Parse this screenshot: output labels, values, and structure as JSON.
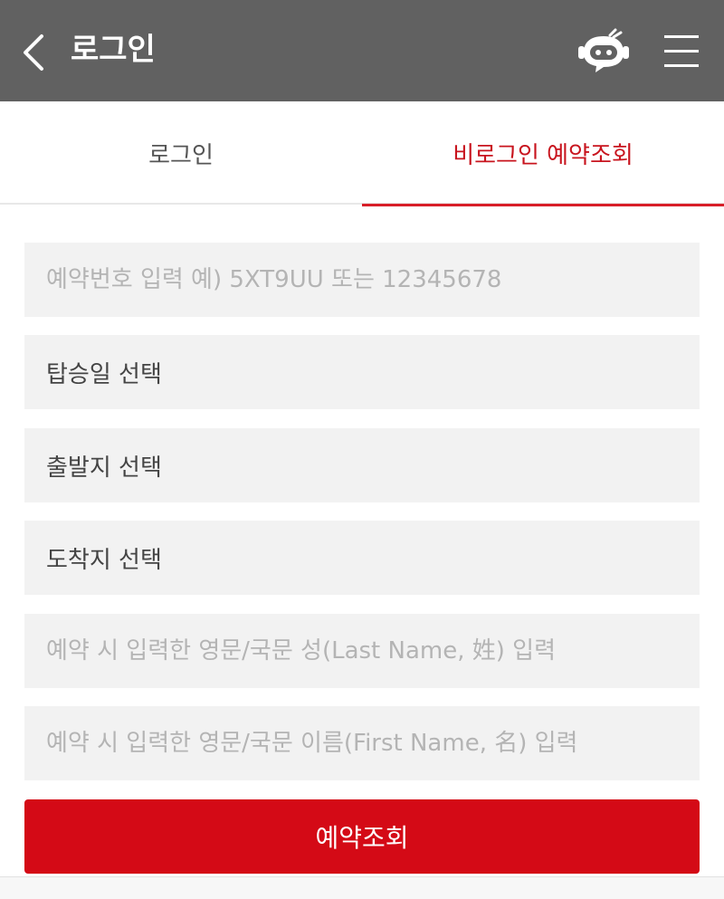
{
  "header": {
    "title": "로그인",
    "back_icon": "chevron-left-icon",
    "chatbot_icon": "robot-icon",
    "menu_icon": "hamburger-menu-icon",
    "bg_color": "#616161"
  },
  "tabs": [
    {
      "label": "로그인",
      "active": false
    },
    {
      "label": "비로그인 예약조회",
      "active": true
    }
  ],
  "form": {
    "reservation_number": {
      "value": "",
      "placeholder": "예약번호 입력 예) 5XT9UU 또는 12345678"
    },
    "boarding_date": {
      "label": "탑승일 선택"
    },
    "departure": {
      "label": "출발지 선택"
    },
    "arrival": {
      "label": "도착지 선택"
    },
    "last_name": {
      "value": "",
      "placeholder": "예약 시 입력한 영문/국문 성(Last Name, 姓) 입력"
    },
    "first_name": {
      "value": "",
      "placeholder": "예약 시 입력한 영문/국문 이름(First Name, 名) 입력"
    },
    "submit_label": "예약조회"
  },
  "colors": {
    "accent": "#d40a16",
    "field_bg": "#f2f2f2"
  }
}
